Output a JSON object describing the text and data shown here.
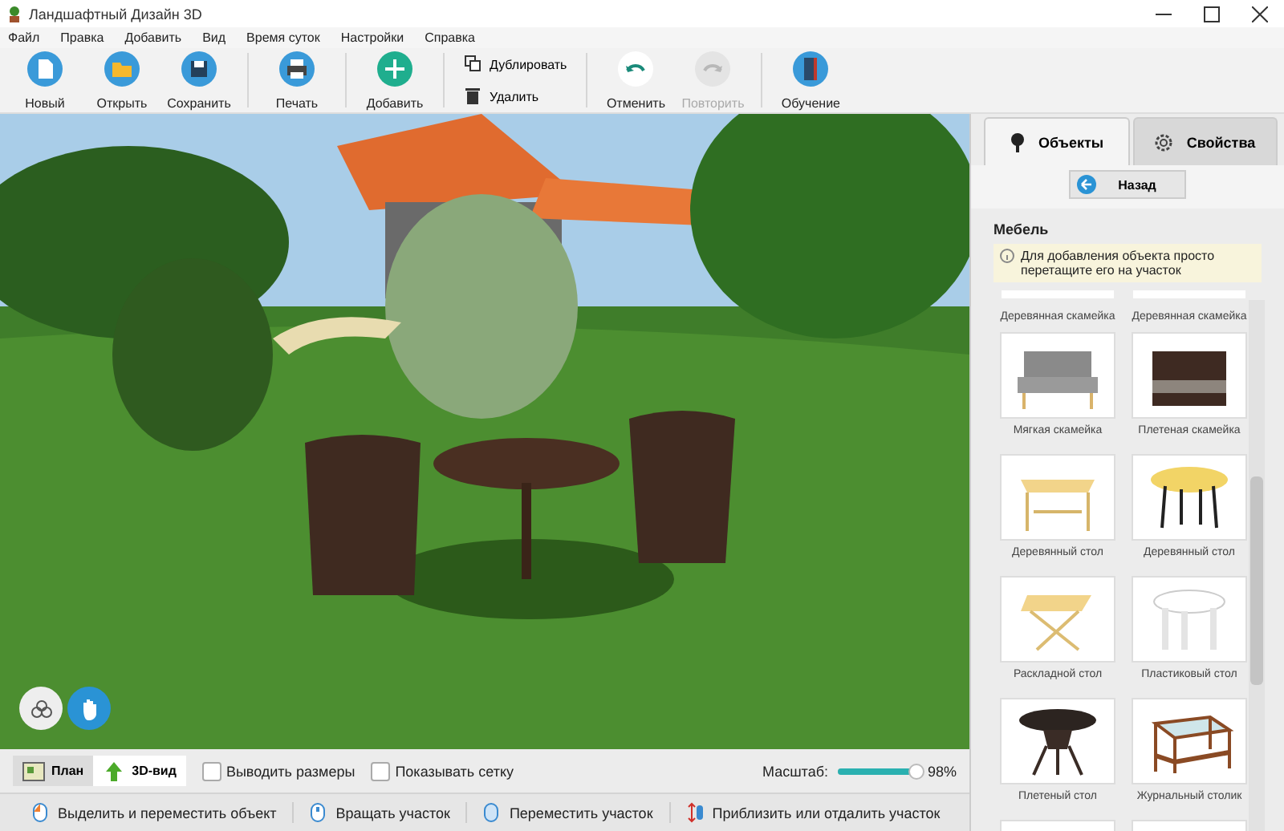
{
  "window": {
    "title": "Ландшафтный Дизайн 3D"
  },
  "menu": [
    "Файл",
    "Правка",
    "Добавить",
    "Вид",
    "Время суток",
    "Настройки",
    "Справка"
  ],
  "toolbar": [
    {
      "kind": "big",
      "label": "Новый",
      "disabled": false
    },
    {
      "kind": "big",
      "label": "Открыть",
      "disabled": false
    },
    {
      "kind": "big",
      "label": "Сохранить",
      "disabled": false
    },
    {
      "kind": "sep"
    },
    {
      "kind": "big",
      "label": "Печать",
      "disabled": false
    },
    {
      "kind": "sep"
    },
    {
      "kind": "big",
      "label": "Добавить",
      "disabled": false
    },
    {
      "kind": "sep"
    },
    {
      "kind": "pair",
      "items": [
        {
          "label": "Дублировать"
        },
        {
          "label": "Удалить"
        }
      ]
    },
    {
      "kind": "sep"
    },
    {
      "kind": "big",
      "label": "Отменить",
      "disabled": false
    },
    {
      "kind": "big",
      "label": "Повторить",
      "disabled": true
    },
    {
      "kind": "sep"
    },
    {
      "kind": "big",
      "label": "Обучение",
      "disabled": false
    }
  ],
  "panel": {
    "tabs": [
      {
        "label": "Объекты",
        "selected": true
      },
      {
        "label": "Свойства",
        "selected": false
      }
    ],
    "back_button": "Назад",
    "heading": "Мебель",
    "hint": "Для добавления объекта просто перетащите его на участок",
    "items": [
      {
        "kind": "cut-top",
        "label": "Деревянная скамейка"
      },
      {
        "kind": "cut-top",
        "label": "Деревянная скамейка"
      },
      {
        "kind": "full",
        "label": "Мягкая скамейка"
      },
      {
        "kind": "full",
        "label": "Плетеная скамейка"
      },
      {
        "kind": "full",
        "label": "Деревянный стол"
      },
      {
        "kind": "full",
        "label": "Деревянный стол"
      },
      {
        "kind": "full",
        "label": "Раскладной стол"
      },
      {
        "kind": "full",
        "label": "Пластиковый стол"
      },
      {
        "kind": "full",
        "label": "Плетеный стол"
      },
      {
        "kind": "full",
        "label": "Журнальный столик"
      },
      {
        "kind": "cut-bottom"
      },
      {
        "kind": "cut-bottom"
      }
    ]
  },
  "view_tabs": [
    {
      "label": "План",
      "selected": false
    },
    {
      "label": "3D-вид",
      "selected": true
    }
  ],
  "options": [
    {
      "label": "Выводить размеры",
      "checked": false
    },
    {
      "label": "Показывать сетку",
      "checked": false
    }
  ],
  "zoom": {
    "label": "Масштаб:",
    "level": 0.98,
    "reading": "98%"
  },
  "hints": [
    "Выделить и переместить объект",
    "Вращать участок",
    "Переместить участок",
    "Приблизить или отдалить участок"
  ]
}
